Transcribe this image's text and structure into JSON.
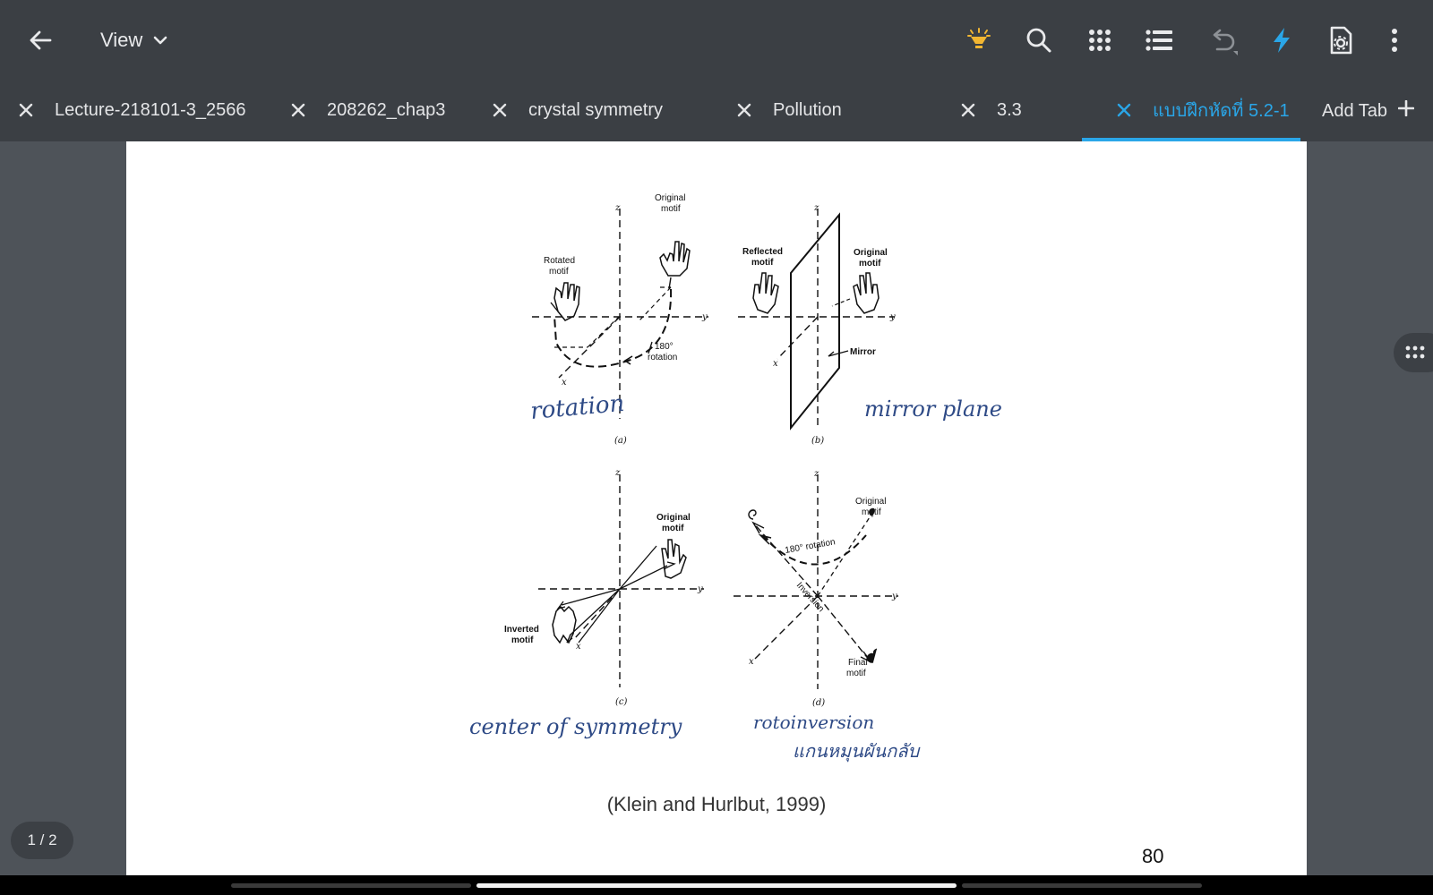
{
  "toolbar": {
    "view_label": "View"
  },
  "tabs": [
    {
      "label": "Lecture-218101-3_2566"
    },
    {
      "label": "208262_chap3"
    },
    {
      "label": "crystal symmetry"
    },
    {
      "label": "Pollution"
    },
    {
      "label": "3.3"
    },
    {
      "label": "แบบฝึกหัดที่ 5.2-1",
      "active": true
    }
  ],
  "add_tab_label": "Add Tab",
  "document": {
    "figure": {
      "panel_a": {
        "original": [
          "Original",
          "motif"
        ],
        "rotated": [
          "Rotated",
          "motif"
        ],
        "rotation": [
          "180°",
          "rotation"
        ],
        "caption": "(a)",
        "handwritten": "rotation"
      },
      "panel_b": {
        "reflected": [
          "Reflected",
          "motif"
        ],
        "original": [
          "Original",
          "motif"
        ],
        "mirror": "Mirror",
        "caption": "(b)",
        "handwritten": "mirror plane"
      },
      "panel_c": {
        "original": [
          "Original",
          "motif"
        ],
        "inverted": [
          "Inverted",
          "motif"
        ],
        "caption": "(c)",
        "handwritten": "center of symmetry"
      },
      "panel_d": {
        "original": [
          "Original",
          "motif"
        ],
        "rotation": "180° rotation",
        "inversion": "Inversion",
        "final": [
          "Final",
          "motif"
        ],
        "caption": "(d)",
        "handwritten_1": "rotoinversion",
        "handwritten_2": "แกนหมุนผันกลับ"
      },
      "axes": {
        "x": "x",
        "y": "y",
        "z": "z"
      }
    },
    "citation": "(Klein and Hurlbut, 1999)",
    "page_number": "80"
  },
  "page_indicator": "1 / 2",
  "colors": {
    "toolbar_bg": "#3b3f44",
    "canvas_bg": "#4e5359",
    "accent": "#2aa6e8",
    "idea_icon": "#f2b632",
    "handwriting": "#2e4a86"
  },
  "icons": [
    "back-arrow-icon",
    "chevron-down-icon",
    "lightbulb-icon",
    "search-icon",
    "grid-icon",
    "list-icon",
    "undo-icon",
    "lightning-icon",
    "document-settings-icon",
    "more-vert-icon",
    "close-icon",
    "plus-icon",
    "side-handle-icon"
  ]
}
